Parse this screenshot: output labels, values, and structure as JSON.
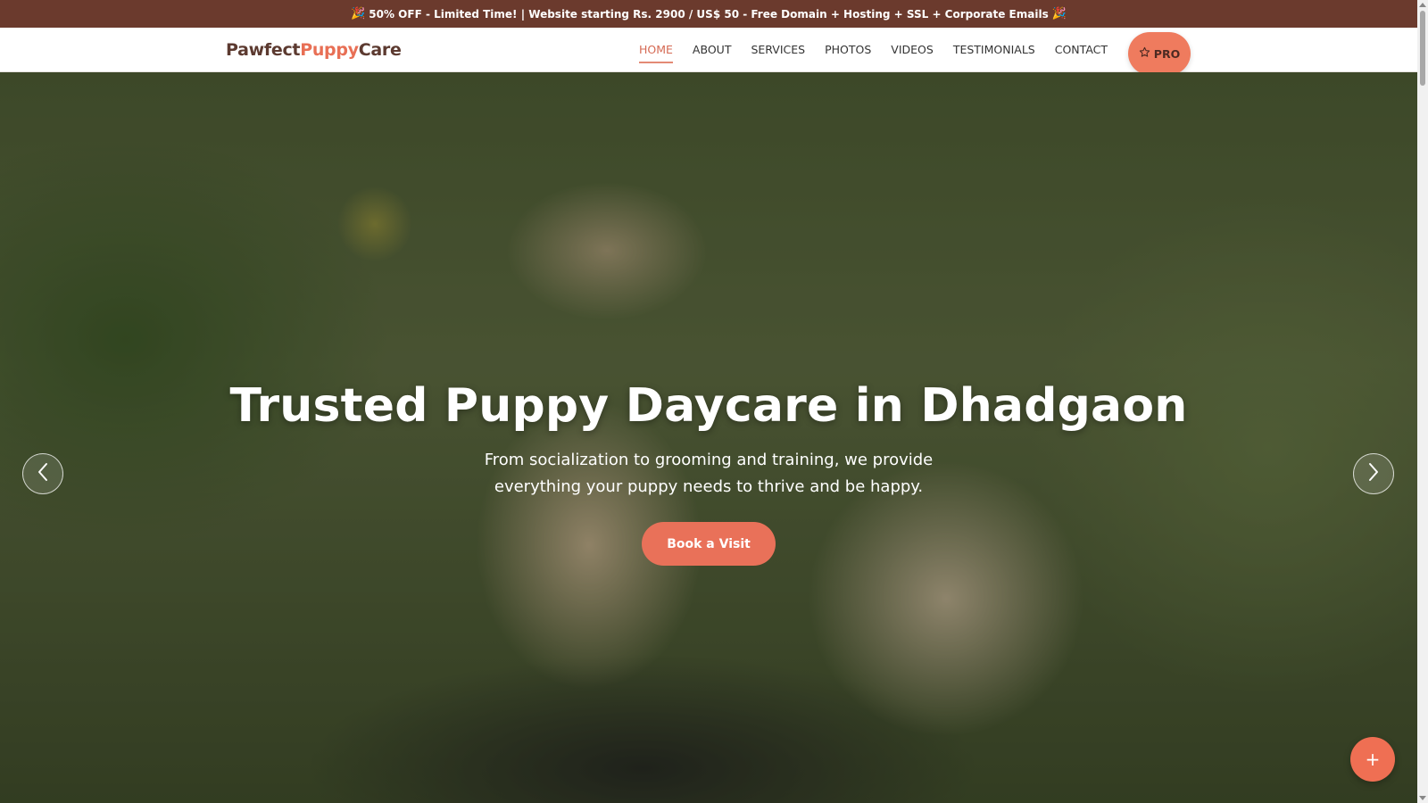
{
  "promo": {
    "emoji_left": "🎉",
    "text": "50% OFF - Limited Time! | Website starting Rs. 2900 / US$ 50 - Free Domain + Hosting + SSL + Corporate Emails",
    "emoji_right": "🎉"
  },
  "brand": {
    "part1": "Pawfect",
    "part2": "Puppy",
    "part3": "Care"
  },
  "nav": {
    "items": [
      {
        "label": "HOME"
      },
      {
        "label": "ABOUT"
      },
      {
        "label": "SERVICES"
      },
      {
        "label": "PHOTOS"
      },
      {
        "label": "VIDEOS"
      },
      {
        "label": "TESTIMONIALS"
      },
      {
        "label": "CONTACT"
      }
    ],
    "pro_label": "PRO",
    "pro_icon": "star-outline-icon"
  },
  "hero": {
    "title": "Trusted Puppy Daycare in Dhadgaon",
    "subtitle": "From socialization to grooming and training, we provide everything your puppy needs to thrive and be happy.",
    "cta_label": "Book a Visit",
    "prev_icon": "chevron-left-icon",
    "next_icon": "chevron-right-icon"
  },
  "fab": {
    "label": "+"
  },
  "colors": {
    "promo_bg": "#6b3a2d",
    "brand_dark": "#5c3a30",
    "accent": "#e97159",
    "nav_active": "#d56a54"
  }
}
